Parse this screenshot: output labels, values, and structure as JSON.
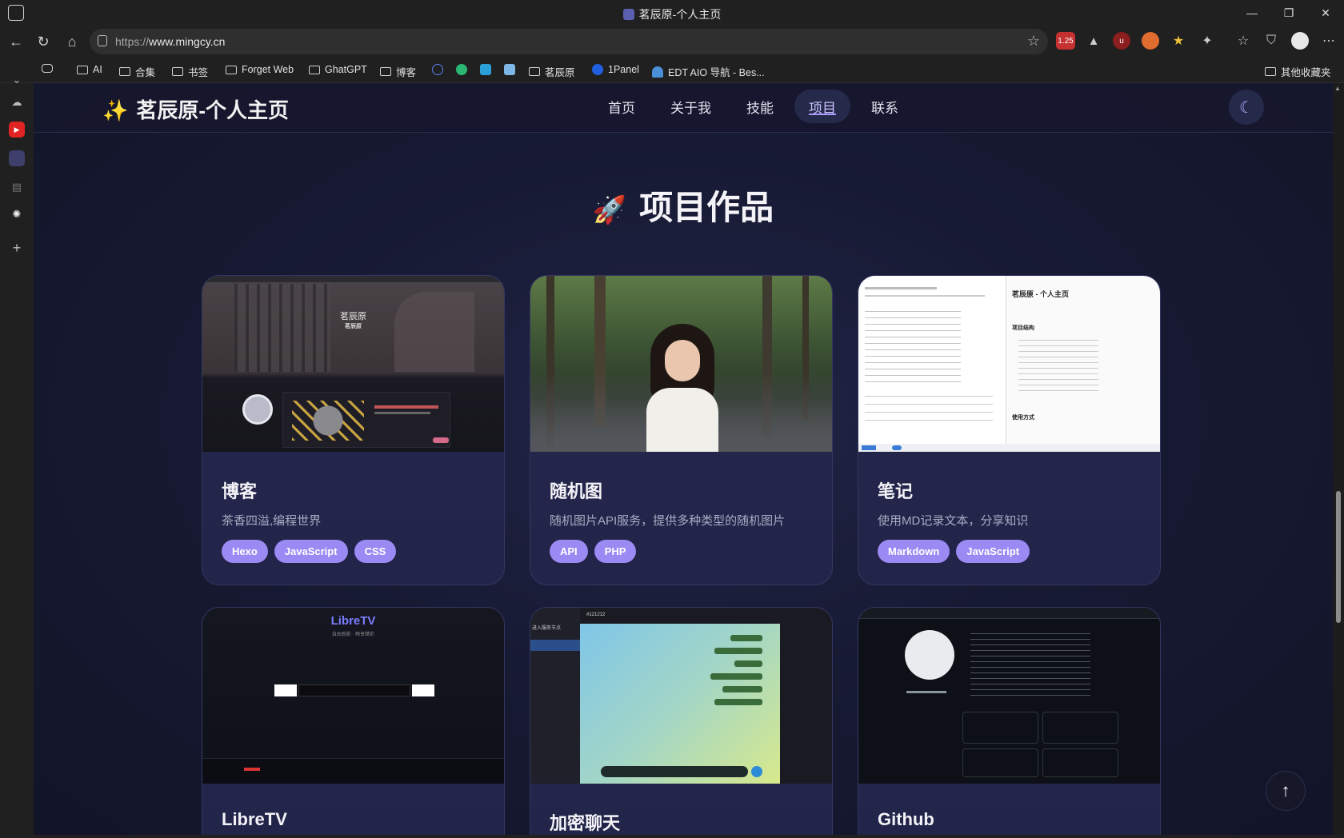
{
  "browser": {
    "tab_title": "茗辰原-个人主页",
    "url_scheme": "https://",
    "url_host": "www.mingcy.cn",
    "window_controls": [
      "—",
      "❐",
      "✕"
    ],
    "extension_badge": "1.25"
  },
  "bookmarks": [
    {
      "label": "AI",
      "type": "folder"
    },
    {
      "label": "合集",
      "type": "folder"
    },
    {
      "label": "书签",
      "type": "folder"
    },
    {
      "label": "Forget Web",
      "type": "folder"
    },
    {
      "label": "GhatGPT",
      "type": "folder"
    },
    {
      "label": "博客",
      "type": "folder"
    },
    {
      "label": "茗辰原",
      "type": "folder"
    },
    {
      "label": "1Panel",
      "type": "link"
    },
    {
      "label": "EDT AIO 导航 - Bes...",
      "type": "link"
    },
    {
      "label": "其他收藏夹",
      "type": "folder"
    }
  ],
  "site": {
    "logo_text": "茗辰原-个人主页",
    "nav": [
      "首页",
      "关于我",
      "技能",
      "项目",
      "联系"
    ],
    "active_nav": "项目",
    "section_title": "项目作品",
    "accent_color": "#9b8af3"
  },
  "projects": [
    {
      "name": "博客",
      "desc": "茶香四溢,编程世界",
      "tags": [
        "Hexo",
        "JavaScript",
        "CSS"
      ],
      "thumb": "blog",
      "thumb_text": [
        "茗辰原",
        "茗辰原"
      ]
    },
    {
      "name": "随机图",
      "desc": "随机图片API服务，提供多种类型的随机图片",
      "tags": [
        "API",
        "PHP"
      ],
      "thumb": "photo",
      "thumb_text": []
    },
    {
      "name": "笔记",
      "desc": "使用MD记录文本，分享知识",
      "tags": [
        "Markdown",
        "JavaScript"
      ],
      "thumb": "notes",
      "thumb_text": [
        "茗辰原 - 个人主页",
        "项目结构",
        "使用方式"
      ]
    },
    {
      "name": "LibreTV",
      "desc": "",
      "tags": [],
      "thumb": "libretv",
      "thumb_text": [
        "LibreTV",
        "自由观影 · 畅享精彩"
      ]
    },
    {
      "name": "加密聊天",
      "desc": "",
      "tags": [],
      "thumb": "chat",
      "thumb_text": [
        "#121212",
        "进入服务节点"
      ]
    },
    {
      "name": "Github",
      "desc": "",
      "tags": [],
      "thumb": "github",
      "thumb_text": []
    }
  ]
}
